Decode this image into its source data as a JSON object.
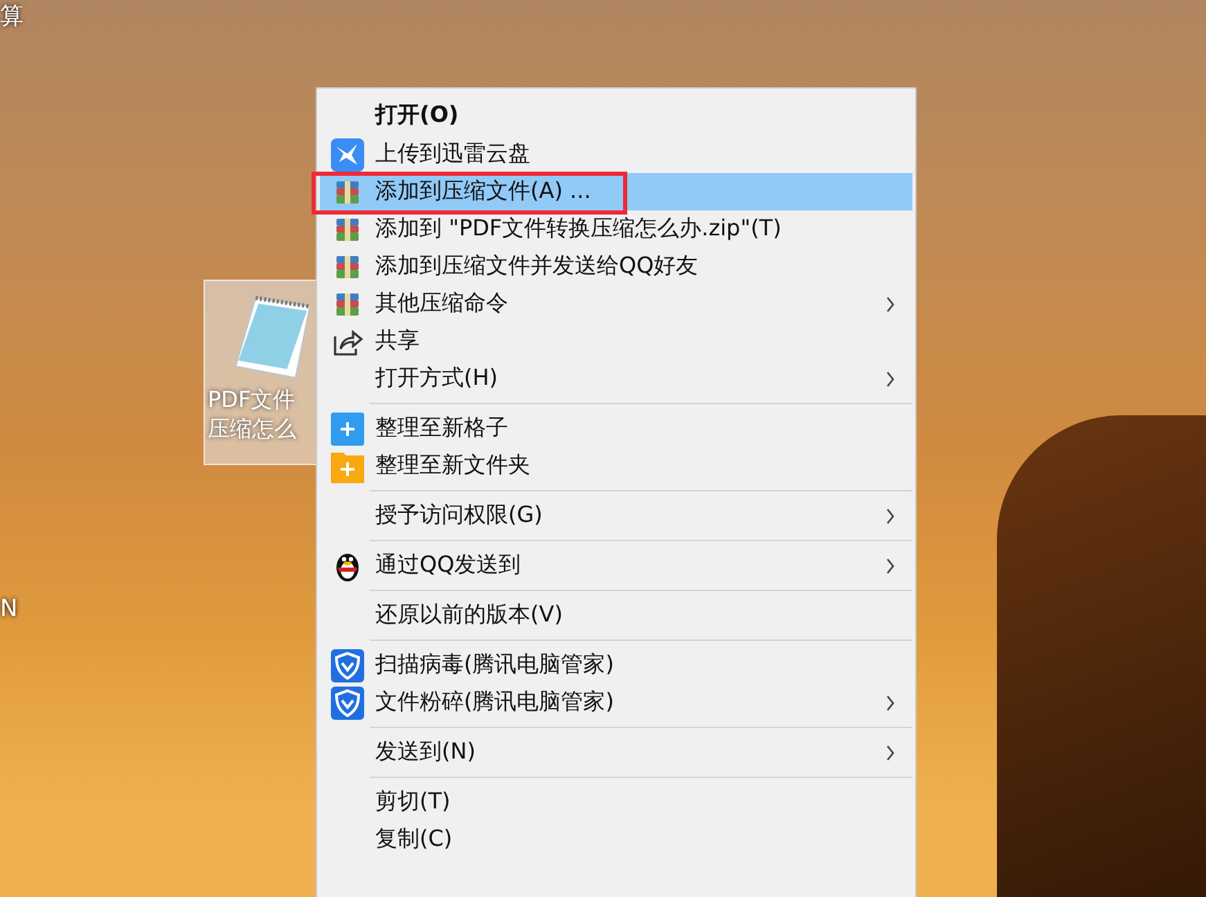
{
  "desktop": {
    "edge_labels": [
      {
        "text": "算"
      },
      {
        "text": "N"
      }
    ],
    "file_icon": {
      "label_lines": [
        "PDF文件",
        "压缩怎么"
      ],
      "selected": true
    }
  },
  "context_menu": {
    "items": [
      {
        "kind": "plain",
        "label": "打开(O)",
        "bold": true,
        "submenu": false,
        "selected": false,
        "outlined": false
      },
      {
        "kind": "bird",
        "label": "上传到迅雷云盘",
        "bold": false,
        "submenu": false,
        "selected": false,
        "outlined": false
      },
      {
        "kind": "archive",
        "label": "添加到压缩文件(A) ...",
        "bold": false,
        "submenu": false,
        "selected": true,
        "outlined": true
      },
      {
        "kind": "archive",
        "label": "添加到 \"PDF文件转换压缩怎么办.zip\"(T)",
        "bold": false,
        "submenu": false,
        "selected": false,
        "outlined": false
      },
      {
        "kind": "archive",
        "label": "添加到压缩文件并发送给QQ好友",
        "bold": false,
        "submenu": false,
        "selected": false,
        "outlined": false
      },
      {
        "kind": "archive",
        "label": "其他压缩命令",
        "bold": false,
        "submenu": true,
        "selected": false,
        "outlined": false
      },
      {
        "kind": "share",
        "label": "共享",
        "bold": false,
        "submenu": false,
        "selected": false,
        "outlined": false
      },
      {
        "kind": "plain",
        "label": "打开方式(H)",
        "bold": false,
        "submenu": true,
        "selected": false,
        "outlined": false
      },
      {
        "kind": "separator"
      },
      {
        "kind": "plus",
        "label": "整理至新格子",
        "bold": false,
        "submenu": false,
        "selected": false,
        "outlined": false
      },
      {
        "kind": "folder",
        "label": "整理至新文件夹",
        "bold": false,
        "submenu": false,
        "selected": false,
        "outlined": false
      },
      {
        "kind": "separator"
      },
      {
        "kind": "plain",
        "label": "授予访问权限(G)",
        "bold": false,
        "submenu": true,
        "selected": false,
        "outlined": false
      },
      {
        "kind": "separator"
      },
      {
        "kind": "penguin",
        "label": "通过QQ发送到",
        "bold": false,
        "submenu": true,
        "selected": false,
        "outlined": false
      },
      {
        "kind": "separator"
      },
      {
        "kind": "plain",
        "label": "还原以前的版本(V)",
        "bold": false,
        "submenu": false,
        "selected": false,
        "outlined": false
      },
      {
        "kind": "separator"
      },
      {
        "kind": "shield",
        "label": "扫描病毒(腾讯电脑管家)",
        "bold": false,
        "submenu": false,
        "selected": false,
        "outlined": false
      },
      {
        "kind": "shield",
        "label": "文件粉碎(腾讯电脑管家)",
        "bold": false,
        "submenu": true,
        "selected": false,
        "outlined": false
      },
      {
        "kind": "separator"
      },
      {
        "kind": "plain",
        "label": "发送到(N)",
        "bold": false,
        "submenu": true,
        "selected": false,
        "outlined": false
      },
      {
        "kind": "separator"
      },
      {
        "kind": "plain",
        "label": "剪切(T)",
        "bold": false,
        "submenu": false,
        "selected": false,
        "outlined": false
      },
      {
        "kind": "plain",
        "label": "复制(C)",
        "bold": false,
        "submenu": false,
        "selected": false,
        "outlined": false
      }
    ]
  }
}
